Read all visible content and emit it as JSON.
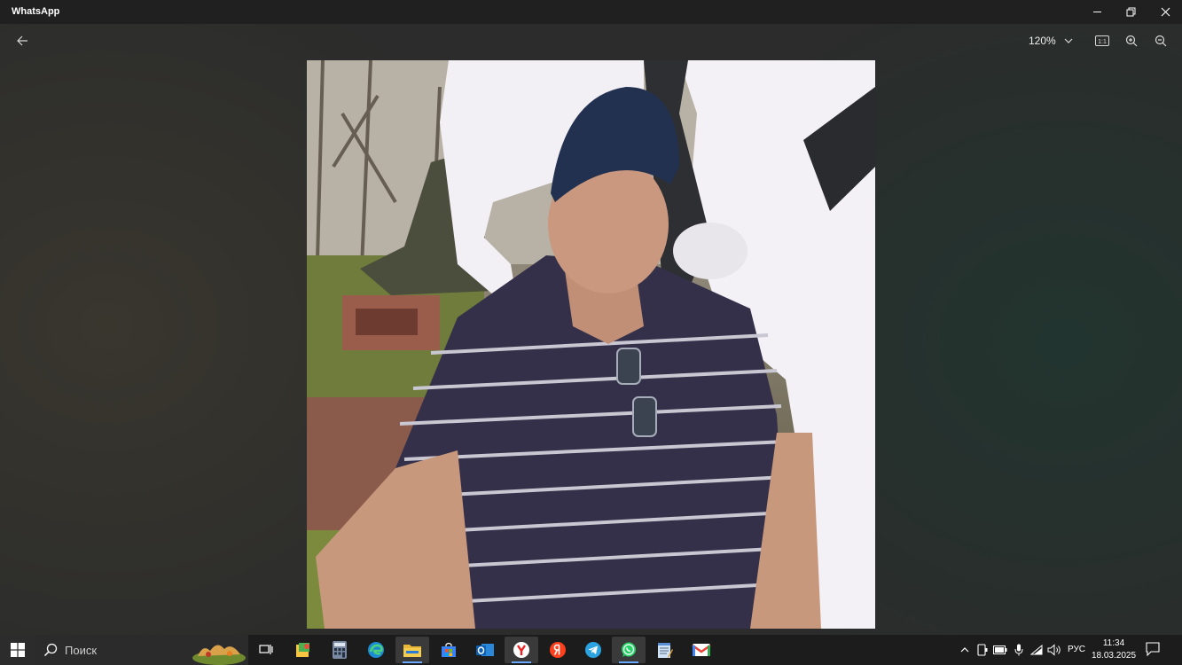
{
  "window": {
    "title": "WhatsApp",
    "controls": [
      "minimize-icon",
      "restore-icon",
      "close-icon"
    ]
  },
  "viewer": {
    "zoom_level": "120%",
    "toolbar_icons": [
      "back-arrow-icon",
      "chevron-down-icon",
      "actual-size-icon",
      "zoom-in-icon",
      "zoom-out-icon"
    ],
    "actual_size_glyph": "1:1"
  },
  "taskbar": {
    "search_placeholder": "Поиск",
    "pinned_apps": [
      "task-view",
      "file-explorer-2",
      "calculator",
      "edge",
      "file-explorer",
      "microsoft-store",
      "outlook",
      "yandex-browser",
      "yandex",
      "telegram",
      "whatsapp",
      "notepad",
      "gmail"
    ],
    "active_app": "whatsapp",
    "tray": {
      "language": "РУС",
      "time": "11:34",
      "date": "18.03.2025"
    },
    "accent_color": "#6aa9ff"
  }
}
